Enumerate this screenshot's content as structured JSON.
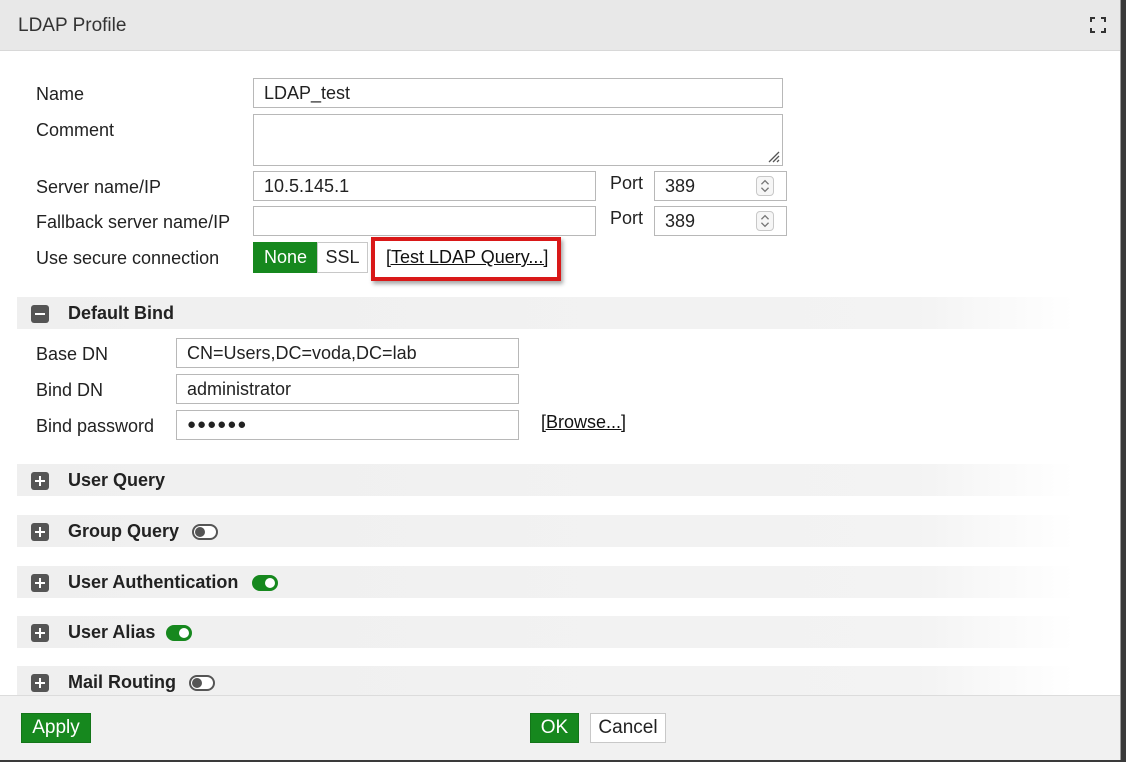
{
  "dialog": {
    "title": "LDAP Profile"
  },
  "form": {
    "name_label": "Name",
    "name_value": "LDAP_test",
    "comment_label": "Comment",
    "comment_value": "",
    "server_label": "Server name/IP",
    "server_value": "10.5.145.1",
    "port_label": "Port",
    "port_value": "389",
    "fallback_label": "Fallback server name/IP",
    "fallback_value": "",
    "fallback_port_label": "Port",
    "fallback_port_value": "389",
    "secure_label": "Use secure connection",
    "secure_options": [
      "None",
      "SSL"
    ],
    "secure_selected": "None",
    "test_query_link": "[Test LDAP Query...]"
  },
  "default_bind": {
    "title": "Default Bind",
    "base_dn_label": "Base DN",
    "base_dn_value": "CN=Users,DC=voda,DC=lab",
    "bind_dn_label": "Bind DN",
    "bind_dn_value": "administrator",
    "bind_password_label": "Bind password",
    "bind_password_value": "●●●●●●",
    "browse_link": "[Browse...]"
  },
  "sections": [
    {
      "title": "User Query",
      "toggle": null
    },
    {
      "title": "Group Query",
      "toggle": "off"
    },
    {
      "title": "User Authentication",
      "toggle": "on"
    },
    {
      "title": "User Alias",
      "toggle": "on"
    },
    {
      "title": "Mail Routing",
      "toggle": "off"
    }
  ],
  "footer": {
    "apply_label": "Apply",
    "ok_label": "OK",
    "cancel_label": "Cancel"
  },
  "colors": {
    "accent_green": "#16881e",
    "highlight_red": "#d91818"
  },
  "icons": {
    "maximize": "maximize-icon",
    "collapse": "minus-square-icon",
    "expand": "plus-square-icon"
  }
}
